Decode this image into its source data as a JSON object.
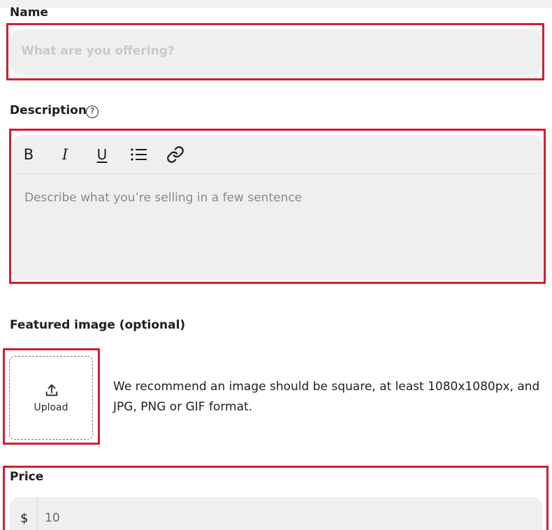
{
  "name_section": {
    "label": "Name",
    "placeholder": "What are you offering?"
  },
  "description_section": {
    "label": "Description",
    "help_icon": "question-circle-icon",
    "toolbar": [
      {
        "name": "bold",
        "icon": "bold-icon",
        "glyph": "B"
      },
      {
        "name": "italic",
        "icon": "italic-icon",
        "glyph": "I"
      },
      {
        "name": "underline",
        "icon": "underline-icon",
        "glyph": "U"
      },
      {
        "name": "bulleted-list",
        "icon": "list-icon"
      },
      {
        "name": "link",
        "icon": "link-icon"
      }
    ],
    "placeholder": "Describe what you’re selling in a few sentence"
  },
  "image_section": {
    "label": "Featured image (optional)",
    "upload_label": "Upload",
    "upload_icon": "upload-icon",
    "hint_line1": "We recommend an image should be square, at least 1080x1080px, and",
    "hint_line2": "JPG, PNG or GIF format."
  },
  "price_section": {
    "label": "Price",
    "currency": "$",
    "value": "10"
  },
  "colors": {
    "highlight": "#d11f2d",
    "field_bg": "#efefef",
    "placeholder_name": "#c9c9c9",
    "placeholder_desc": "#8a8a8a"
  }
}
